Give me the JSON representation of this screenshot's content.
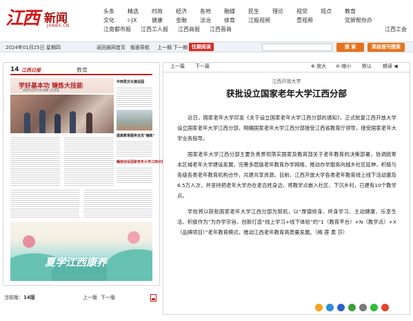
{
  "site": {
    "logo_text": "江西",
    "name": "新闻",
    "domain": "JXNBS.CN"
  },
  "nav": {
    "row1": [
      "头条",
      "精选",
      "时政",
      "经济",
      "各地",
      "融媒",
      "民生",
      "理论",
      "视觉",
      "观点",
      "教育"
    ],
    "row2": [
      "文化",
      "i-JX",
      "健康",
      "金融",
      "法治",
      "体育",
      "江报视频",
      "",
      "壹视频",
      "",
      "党屏帮你办"
    ],
    "row3": [
      "江南都市报",
      "江西工人报",
      "江西商报",
      "江西晋商",
      "江西工会"
    ]
  },
  "toolbar": {
    "date": "2024年01月25日 星期四",
    "home": "返回报网首页",
    "version_nav": "版面导航",
    "prev": "上一期",
    "next": "下一期",
    "past": "往期阅读",
    "search_btn": "搜 索",
    "adv_search_btn": "高级报刊搜索"
  },
  "page": {
    "num": "14",
    "logo": "江西日报",
    "section": "教育",
    "np_title": "学好基本功 锤炼大技能",
    "np_sub": "南昌市技师学院·赣鄱工匠摇篮",
    "right_titles": [
      "中西再文化建设国",
      "提高教育服务全员\"锤炼\"",
      "赣南创设国家老年大学江西分部"
    ],
    "ad_text": "夏学江西康养"
  },
  "left_footer": {
    "current": "当前版：",
    "current_num": "14版",
    "prev": "上一版",
    "next": "下一版"
  },
  "article": {
    "prev": "上一篇",
    "next": "下一篇",
    "bigger": "放大",
    "smaller": "缩小",
    "reset": "默认",
    "read": "朗读",
    "kicker": "江西开放大学",
    "title": "获批设立国家老年大学江西分部",
    "paragraphs": [
      "近日，国家老年大学印发《关于设立国家老年大学江西分部的通知》，正式批复江西开放大学设立国家老年大学江西分部，明确国家老年大学江西分部接受江西省教育厅领导，接受国家老年大学业务指导。",
      "国家老年大学江西分部主要负责贯彻落实国家及教育部关于老年教育的决策部署，协调统筹本区域老年大学建设发展，完善多层级老年教育办学网络，推动办学服务向城乡社区延伸，积极与各级各类老年教育机构合作，共建共享资源。目前，江西开放大学各类老年教育线上线下活动惠及6.5万人次，并坚持把老年大学办在老百姓身边，将教学点嵌入社区、下沉乡村，已建有10个教学点。",
      "学校将以获批国家老年大学江西分部为契机，以“厚德修身、终身学习、主动健康、乐享生活、积极作为”为办学宗旨，创新打造“线上学习+线下体验”的“1（教育平台）+N（教学点）+X（品牌项目）”老年教育模式，推动江西老年教育高质量发展。（梅 莲 黄 莎）"
    ]
  },
  "share": {
    "icons": [
      "qzone-icon",
      "tencent-weibo-icon",
      "renren-icon",
      "douban-icon",
      "share-icon",
      "wechat-icon",
      "weibo-icon"
    ]
  }
}
